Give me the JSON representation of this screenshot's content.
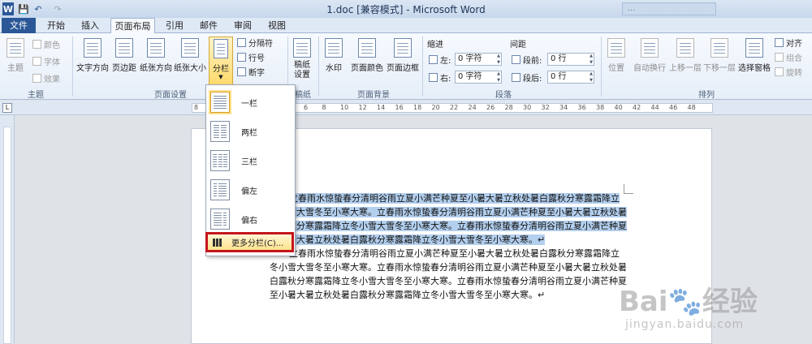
{
  "window": {
    "title": "1.doc [兼容模式] - Microsoft Word",
    "ghost_window": "…",
    "quick_access": [
      "W",
      "💾",
      "↶",
      "↷"
    ]
  },
  "tabs": [
    "文件",
    "开始",
    "插入",
    "页面布局",
    "引用",
    "邮件",
    "审阅",
    "视图"
  ],
  "active_tab": "页面布局",
  "ribbon": {
    "theme_group": {
      "label": "主题",
      "theme_btn": "主题",
      "colors": "颜色",
      "fonts": "字体",
      "effects": "效果"
    },
    "page_setup": {
      "label": "页面设置",
      "text_direction": "文字方向",
      "margins": "页边距",
      "orientation": "纸张方向",
      "size": "纸张大小",
      "columns": "分栏",
      "breaks": "分隔符",
      "line_numbers": "行号",
      "hyphenation": "断字"
    },
    "draft": {
      "label": "稿纸",
      "draft_settings": "稿纸\n设置"
    },
    "page_background": {
      "label": "页面背景",
      "watermark": "水印",
      "page_color": "页面颜色",
      "page_borders": "页面边框"
    },
    "paragraph": {
      "label": "段落",
      "indent": "缩进",
      "spacing": "间距",
      "left_label": "左:",
      "left_value": "0 字符",
      "right_label": "右:",
      "right_value": "0 字符",
      "before_label": "段前:",
      "before_value": "0 行",
      "after_label": "段后:",
      "after_value": "0 行"
    },
    "arrange": {
      "label": "排列",
      "position": "位置",
      "wrap": "自动换行",
      "bring_forward": "上移一层",
      "send_backward": "下移一层",
      "selection_pane": "选择窗格",
      "align": "对齐",
      "group": "组合",
      "rotate": "旋转"
    }
  },
  "columns_menu": {
    "items": [
      "一栏",
      "两栏",
      "三栏",
      "偏左",
      "偏右"
    ],
    "more": "更多分栏(C)..."
  },
  "ruler": {
    "corner": "L",
    "numbers": [
      "8",
      "6",
      "4",
      "2",
      "2",
      "4",
      "6",
      "8",
      "10",
      "12",
      "14",
      "16",
      "18",
      "20",
      "22",
      "24",
      "26",
      "28",
      "30",
      "32",
      "34",
      "36",
      "38",
      "40",
      "42",
      "44",
      "46",
      "48"
    ]
  },
  "document": {
    "lines": [
      "立春雨水惊蛰春分清明谷雨立夏小满芒种夏至小暑大暑立秋处暑白露秋分寒露霜降立",
      "冬小雪大雪冬至小寒大寒。立春雨水惊蛰春分清明谷雨立夏小满芒种夏至小暑大暑立秋处暑",
      "白露秋分寒露霜降立冬小雪大雪冬至小寒大寒。立春雨水惊蛰春分清明谷雨立夏小满芒种夏",
      "至小暑大暑立秋处暑白露秋分寒露霜降立冬小雪大雪冬至小寒大寒。↵",
      "立春雨水惊蛰春分清明谷雨立夏小满芒种夏至小暑大暑立秋处暑白露秋分寒露霜降立",
      "冬小雪大雪冬至小寒大寒。立春雨水惊蛰春分清明谷雨立夏小满芒种夏至小暑大暑立秋处暑",
      "白露秋分寒露霜降立冬小雪大雪冬至小寒大寒。立春雨水惊蛰春分清明谷雨立夏小满芒种夏",
      "至小暑大暑立秋处暑白露秋分寒露霜降立冬小雪大雪冬至小寒大寒。↵"
    ]
  },
  "watermark": {
    "logo": "Bai🐾经验",
    "url": "jingyan.baidu.com"
  },
  "colors": {
    "file_tab": "#2b5797",
    "selection": "#b3cfee",
    "highlight_border": "#c4161c"
  }
}
